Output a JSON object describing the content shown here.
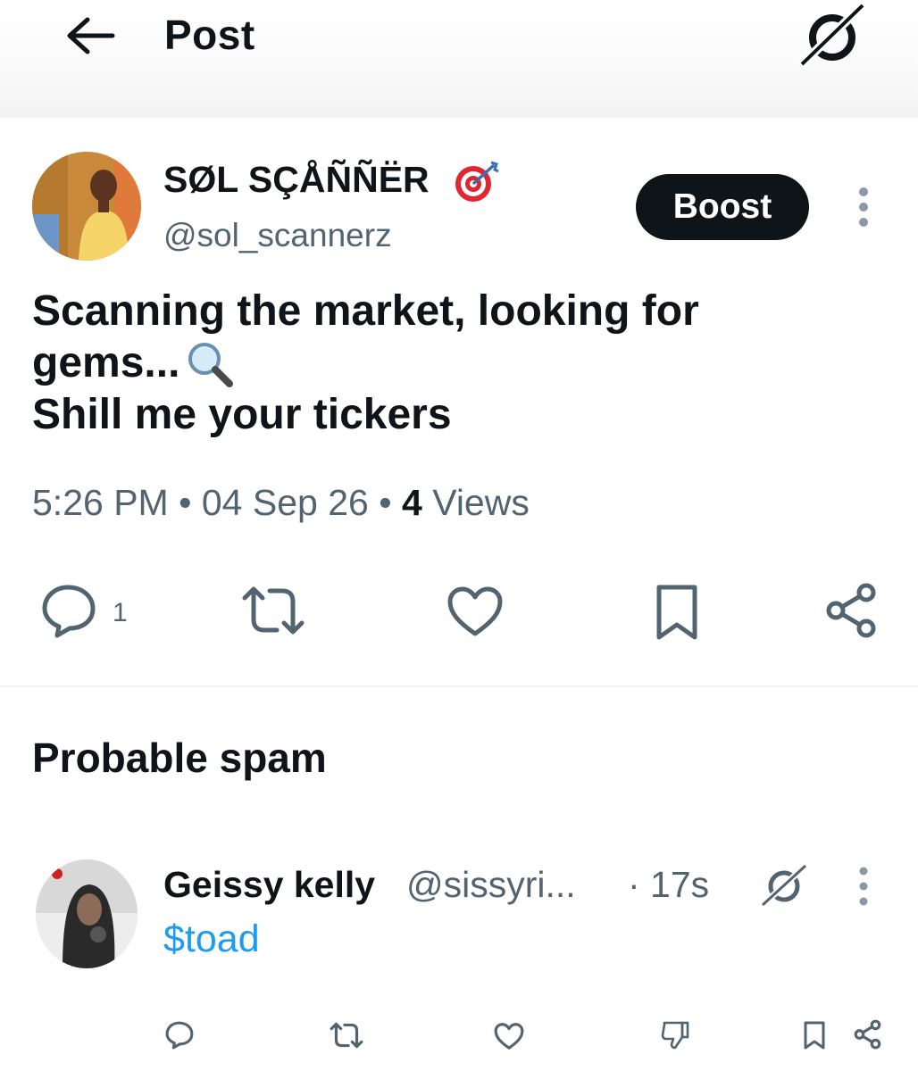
{
  "header": {
    "title": "Post",
    "back_icon": "arrow-left-icon",
    "grok_icon": "grok-icon"
  },
  "post": {
    "author_name": "SØL SÇÅÑÑËR",
    "author_name_emoji": "target-icon",
    "author_handle": "@sol_scannerz",
    "boost_label": "Boost",
    "text_lines": [
      "Scanning the market, looking for",
      "gems...",
      "Shill me your tickers"
    ],
    "text_emoji": "magnifying-glass-icon",
    "time": "5:26 PM",
    "separator": "•",
    "date": "04 Sep 26",
    "views_count": "4",
    "views_label": "Views",
    "actions": {
      "reply_count": "1",
      "reply_icon": "comment-icon",
      "repost_icon": "repost-icon",
      "like_icon": "heart-icon",
      "bookmark_icon": "bookmark-icon",
      "share_icon": "share-icon"
    }
  },
  "replies_section": {
    "title": "Probable spam"
  },
  "reply": {
    "author_name": "Geissy kelly",
    "author_handle": "@sissyri...",
    "time": "· 17s",
    "text": "$toad",
    "actions": {
      "reply_icon": "comment-icon",
      "repost_icon": "repost-icon",
      "like_icon": "heart-icon",
      "downvote_icon": "thumbs-down-icon",
      "bookmark_icon": "bookmark-icon",
      "share_icon": "share-icon"
    }
  },
  "colors": {
    "text": "#0f1419",
    "secondary": "#536471",
    "link": "#1d9bf0",
    "boost_bg": "#0f1419",
    "divider": "#eff3f4"
  }
}
